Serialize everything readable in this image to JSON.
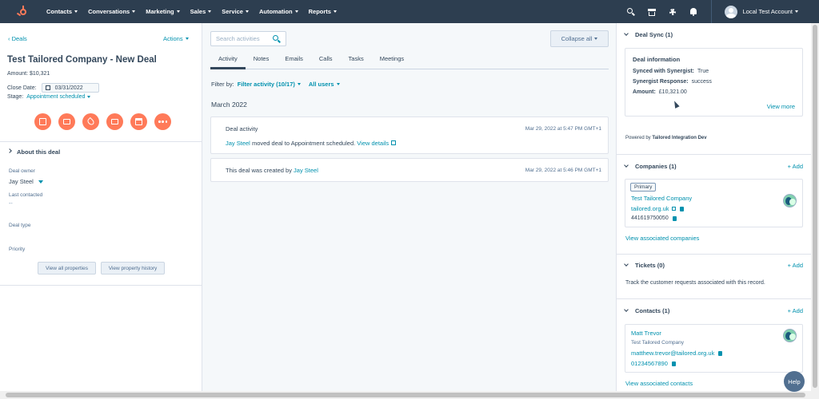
{
  "nav": {
    "items": [
      "Contacts",
      "Conversations",
      "Marketing",
      "Sales",
      "Service",
      "Automation",
      "Reports"
    ],
    "account": "Local Test Account",
    "icons": [
      "search-icon",
      "marketplace-icon",
      "gear-icon",
      "bell-icon"
    ]
  },
  "left": {
    "back": "Deals",
    "actions": "Actions",
    "title": "Test Tailored Company - New Deal",
    "amount": "Amount: $10,321",
    "close_label": "Close Date:",
    "close_date": "03/31/2022",
    "stage_label": "Stage:",
    "stage_value": "Appointment scheduled",
    "about": "About this deal",
    "owner_label": "Deal owner",
    "owner_value": "Jay Steel",
    "last_contacted_label": "Last contacted",
    "last_contacted_value": "--",
    "deal_type_label": "Deal type",
    "priority_label": "Priority",
    "view_all": "View all properties",
    "view_history": "View property history"
  },
  "mid": {
    "search_placeholder": "Search activities",
    "collapse": "Collapse all",
    "tabs": [
      "Activity",
      "Notes",
      "Emails",
      "Calls",
      "Tasks",
      "Meetings"
    ],
    "filter_by": "Filter by:",
    "filter_activity": "Filter activity (10/17)",
    "all_users": "All users",
    "month": "March 2022",
    "card1": {
      "title": "Deal activity",
      "timestamp": "Mar 29, 2022 at 5:47 PM GMT+1",
      "user": "Jay Steel",
      "text": " moved deal to Appointment scheduled. ",
      "link": "View details"
    },
    "card2": {
      "text": "This deal was created by ",
      "user": "Jay Steel",
      "timestamp": "Mar 29, 2022 at 5:46 PM GMT+1"
    }
  },
  "right": {
    "deal_sync": {
      "header": "Deal Sync (1)",
      "title": "Deal information",
      "rows": [
        {
          "label": "Synced with Synergist:",
          "value": "True"
        },
        {
          "label": "Synergist Response:",
          "value": "success"
        },
        {
          "label": "Amount:",
          "value": "£10,321.00"
        }
      ],
      "view_more": "View more",
      "powered_prefix": "Powered by ",
      "powered_name": "Tailored Integration Dev"
    },
    "companies": {
      "header": "Companies (1)",
      "add": "+ Add",
      "tag": "Primary",
      "name": "Test Tailored Company",
      "domain": "tailored.org.uk",
      "phone": "441619750050",
      "view_link": "View associated companies"
    },
    "tickets": {
      "header": "Tickets (0)",
      "add": "+ Add",
      "text": "Track the customer requests associated with this record."
    },
    "contacts": {
      "header": "Contacts (1)",
      "add": "+ Add",
      "name": "Matt Trevor",
      "company": "Test Tailored Company",
      "email": "matthew.trevor@tailored.org.uk",
      "phone": "01234567890",
      "view_link": "View associated contacts"
    }
  },
  "help": "Help"
}
